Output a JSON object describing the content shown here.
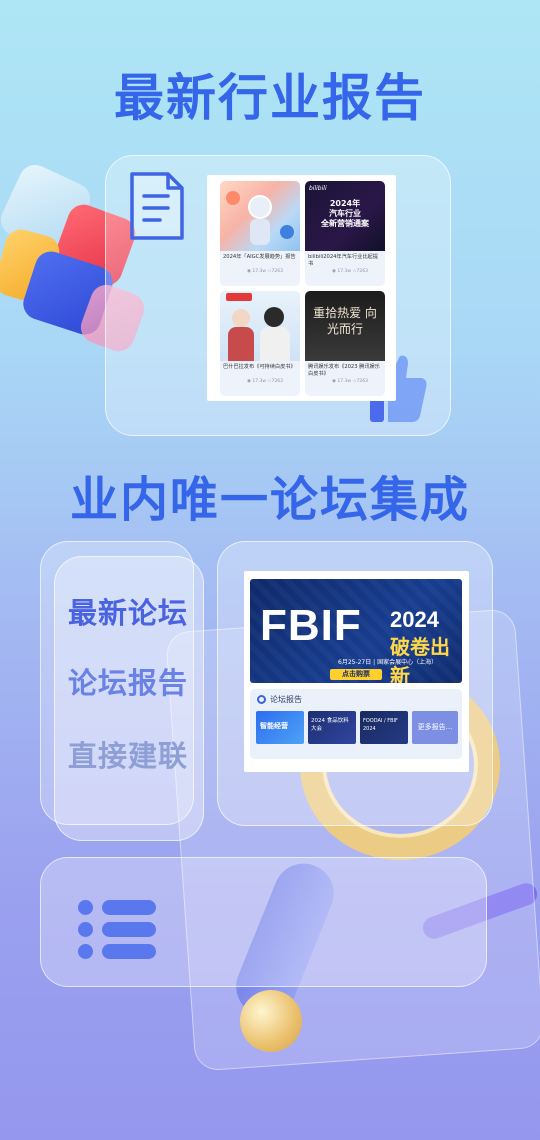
{
  "headings": {
    "latest_reports": "最新行业报告",
    "forum_integration": "业内唯一论坛集成"
  },
  "reports": [
    {
      "title": "2024年「AIGC发展趋势」报告",
      "views": "17.3w",
      "favs": "7263",
      "image_text": ""
    },
    {
      "title": "bilibili2024年汽车行业比起提书",
      "views": "17.3w",
      "favs": "7263",
      "image_text": "2024年\n汽车行业\n全新营销通案"
    },
    {
      "title": "巴什巴拉发布《可持续白皮书》",
      "views": "17.3w",
      "favs": "7263",
      "image_text": ""
    },
    {
      "title": "腾讯娱乐发布《2023 腾讯娱乐白皮书》",
      "views": "17.3w",
      "favs": "7263",
      "image_text": "重拾热爱 向光而行"
    }
  ],
  "bilibili_logo": "bilibili",
  "forum_banner": {
    "brand": "FBIF",
    "year": "2024",
    "slogan": "破卷出新",
    "date_place": "6月25-27日 | 国家会展中心（上海）",
    "ticket_button": "点击购票"
  },
  "forum_reports": {
    "title": "论坛报告",
    "thumbs": [
      "智能经营",
      "2024 食品饮料大会",
      "FOODAI / FBIF 2024"
    ],
    "more_button": "更多报告..."
  },
  "menu": {
    "items": [
      "最新论坛",
      "论坛报告",
      "直接建联"
    ]
  },
  "icons": {
    "document": "document-icon",
    "list": "list-icon",
    "thumbs_up": "thumbs-up-icon",
    "forum_report": "gear-icon"
  },
  "colors": {
    "accent": "#3566ea",
    "menu_active": "#4a63e0",
    "menu_muted": "#8e9fd6"
  }
}
